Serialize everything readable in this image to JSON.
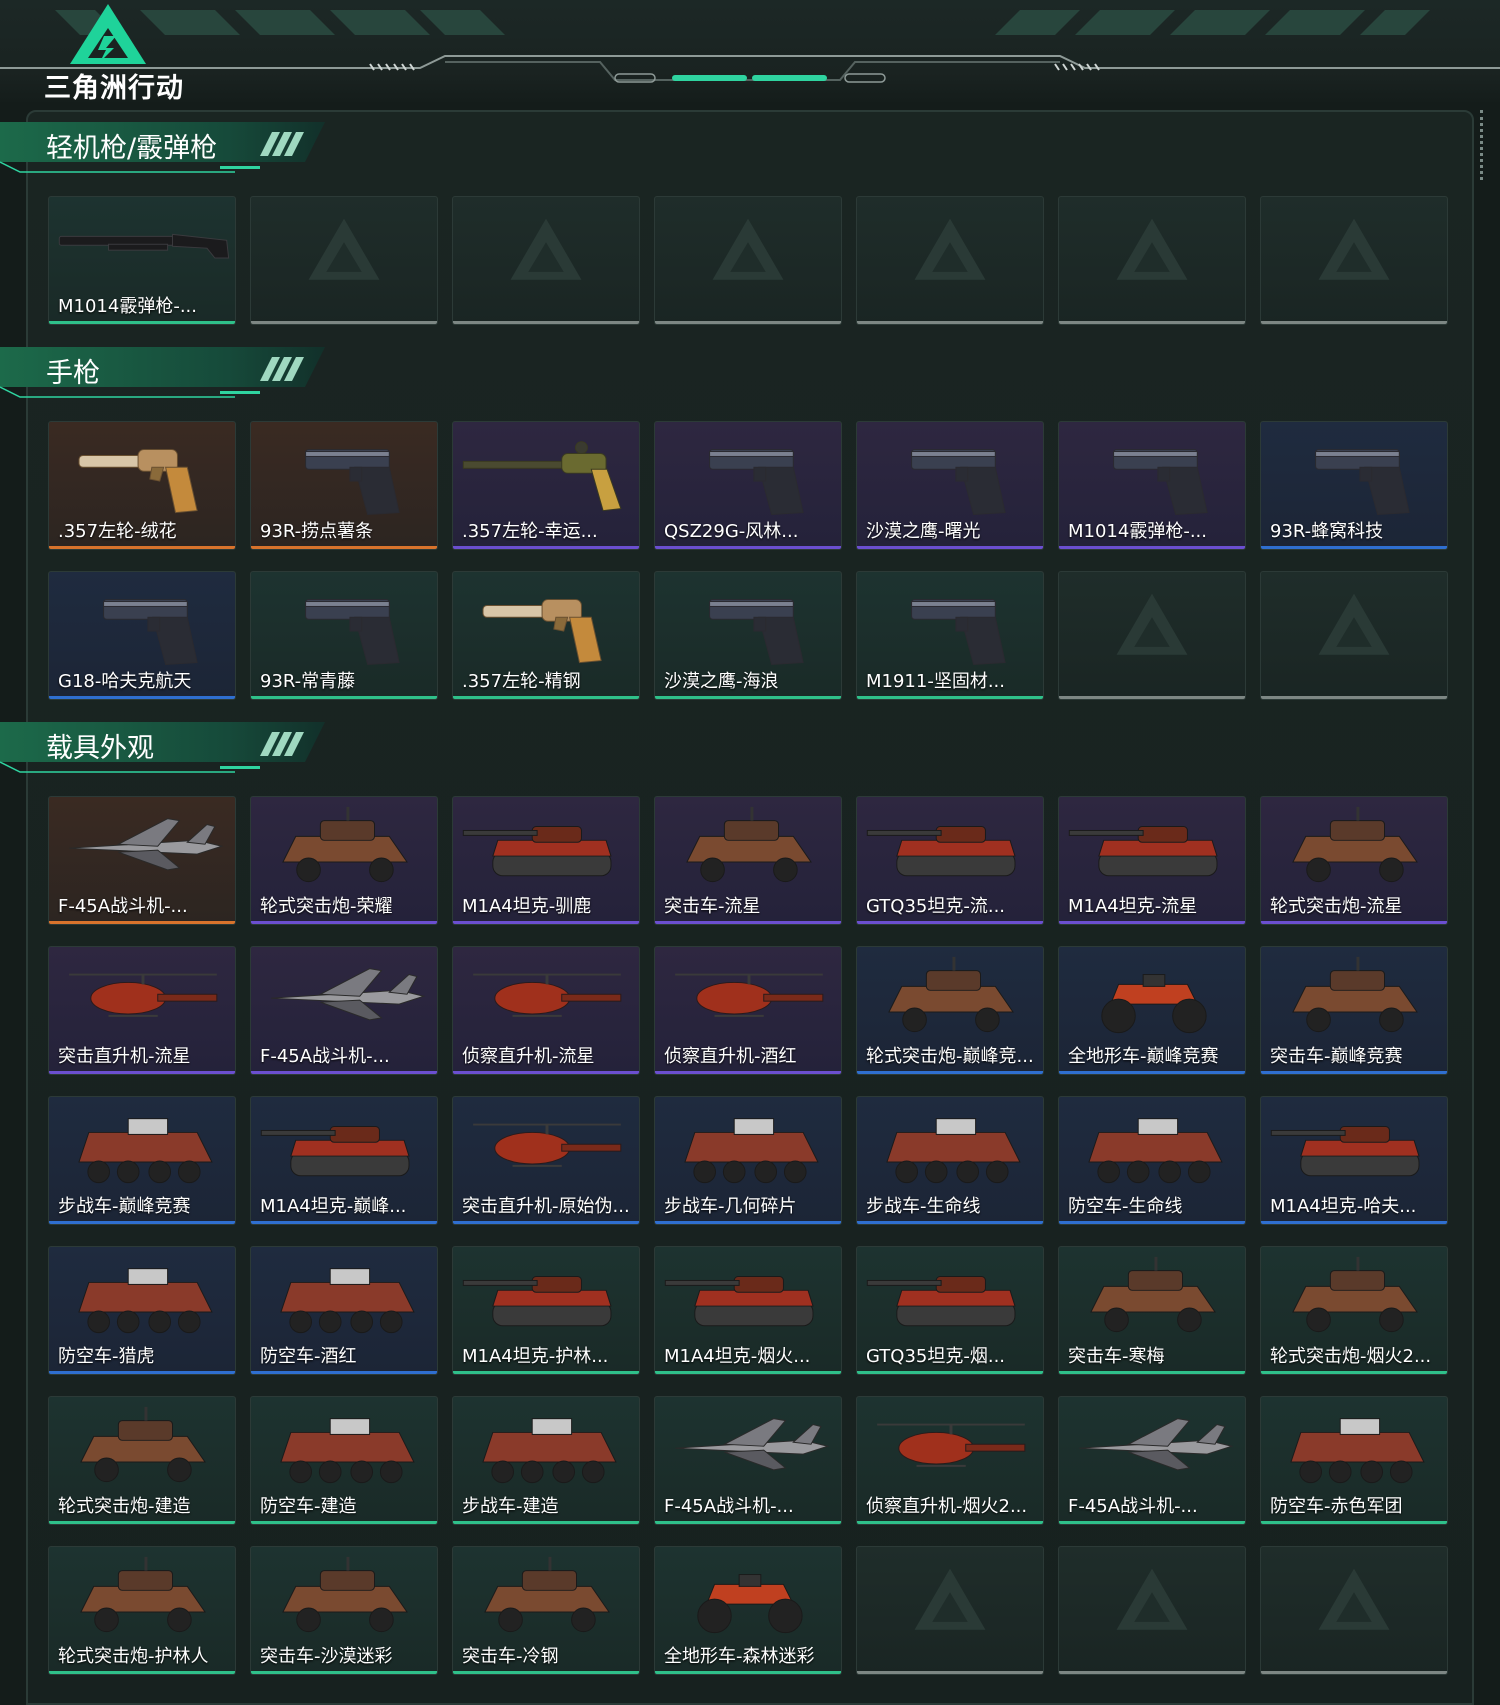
{
  "brand": {
    "logo_text": "三角洲行动"
  },
  "sections": [
    {
      "title": "轻机枪/霰弹枪",
      "items": [
        {
          "label": "M1014霰弹枪-...",
          "rarity": "green",
          "icon": "shotgun"
        },
        {
          "label": "",
          "rarity": "empty",
          "icon": ""
        },
        {
          "label": "",
          "rarity": "empty",
          "icon": ""
        },
        {
          "label": "",
          "rarity": "empty",
          "icon": ""
        },
        {
          "label": "",
          "rarity": "empty",
          "icon": ""
        },
        {
          "label": "",
          "rarity": "empty",
          "icon": ""
        },
        {
          "label": "",
          "rarity": "empty",
          "icon": ""
        }
      ]
    },
    {
      "title": "手枪",
      "items": [
        {
          "label": ".357左轮-绒花",
          "rarity": "orange",
          "icon": "revolver"
        },
        {
          "label": "93R-捞点薯条",
          "rarity": "orange",
          "icon": "pistol"
        },
        {
          "label": ".357左轮-幸运...",
          "rarity": "purple",
          "icon": "long-revolver"
        },
        {
          "label": "QSZ29G-风林...",
          "rarity": "purple",
          "icon": "pistol"
        },
        {
          "label": "沙漠之鹰-曙光",
          "rarity": "purple",
          "icon": "pistol"
        },
        {
          "label": "M1014霰弹枪-...",
          "rarity": "purple",
          "icon": "pistol"
        },
        {
          "label": "93R-蜂窝科技",
          "rarity": "blue",
          "icon": "pistol"
        },
        {
          "label": "G18-哈夫克航天",
          "rarity": "blue",
          "icon": "pistol"
        },
        {
          "label": "93R-常青藤",
          "rarity": "green",
          "icon": "pistol"
        },
        {
          "label": ".357左轮-精钢",
          "rarity": "green",
          "icon": "revolver"
        },
        {
          "label": "沙漠之鹰-海浪",
          "rarity": "green",
          "icon": "pistol"
        },
        {
          "label": "M1911-坚固材...",
          "rarity": "green",
          "icon": "pistol"
        },
        {
          "label": "",
          "rarity": "empty",
          "icon": ""
        },
        {
          "label": "",
          "rarity": "empty",
          "icon": ""
        }
      ]
    },
    {
      "title": "载具外观",
      "items": [
        {
          "label": "F-45A战斗机-...",
          "rarity": "orange",
          "icon": "jet"
        },
        {
          "label": "轮式突击炮-荣耀",
          "rarity": "purple",
          "icon": "car"
        },
        {
          "label": "M1A4坦克-驯鹿",
          "rarity": "purple",
          "icon": "tank"
        },
        {
          "label": "突击车-流星",
          "rarity": "purple",
          "icon": "car"
        },
        {
          "label": "GTQ35坦克-流...",
          "rarity": "purple",
          "icon": "tank"
        },
        {
          "label": "M1A4坦克-流星",
          "rarity": "purple",
          "icon": "tank"
        },
        {
          "label": "轮式突击炮-流星",
          "rarity": "purple",
          "icon": "car"
        },
        {
          "label": "突击直升机-流星",
          "rarity": "purple",
          "icon": "heli"
        },
        {
          "label": "F-45A战斗机-...",
          "rarity": "purple",
          "icon": "jet"
        },
        {
          "label": "侦察直升机-流星",
          "rarity": "purple",
          "icon": "heli"
        },
        {
          "label": "侦察直升机-酒红",
          "rarity": "purple",
          "icon": "heli"
        },
        {
          "label": "轮式突击炮-巅峰竞...",
          "rarity": "blue",
          "icon": "car"
        },
        {
          "label": "全地形车-巅峰竞赛",
          "rarity": "blue",
          "icon": "atv"
        },
        {
          "label": "突击车-巅峰竞赛",
          "rarity": "blue",
          "icon": "car"
        },
        {
          "label": "步战车-巅峰竞赛",
          "rarity": "blue",
          "icon": "apc"
        },
        {
          "label": "M1A4坦克-巅峰...",
          "rarity": "blue",
          "icon": "tank"
        },
        {
          "label": "突击直升机-原始伪...",
          "rarity": "blue",
          "icon": "heli"
        },
        {
          "label": "步战车-几何碎片",
          "rarity": "blue",
          "icon": "apc"
        },
        {
          "label": "步战车-生命线",
          "rarity": "blue",
          "icon": "apc"
        },
        {
          "label": "防空车-生命线",
          "rarity": "blue",
          "icon": "apc"
        },
        {
          "label": "M1A4坦克-哈夫...",
          "rarity": "blue",
          "icon": "tank"
        },
        {
          "label": "防空车-猎虎",
          "rarity": "blue",
          "icon": "apc"
        },
        {
          "label": "防空车-酒红",
          "rarity": "blue",
          "icon": "apc"
        },
        {
          "label": "M1A4坦克-护林...",
          "rarity": "green",
          "icon": "tank"
        },
        {
          "label": "M1A4坦克-烟火...",
          "rarity": "green",
          "icon": "tank"
        },
        {
          "label": "GTQ35坦克-烟...",
          "rarity": "green",
          "icon": "tank"
        },
        {
          "label": "突击车-寒梅",
          "rarity": "green",
          "icon": "car"
        },
        {
          "label": "轮式突击炮-烟火2...",
          "rarity": "green",
          "icon": "car"
        },
        {
          "label": "轮式突击炮-建造",
          "rarity": "green",
          "icon": "car"
        },
        {
          "label": "防空车-建造",
          "rarity": "green",
          "icon": "apc"
        },
        {
          "label": "步战车-建造",
          "rarity": "green",
          "icon": "apc"
        },
        {
          "label": "F-45A战斗机-...",
          "rarity": "green",
          "icon": "jet"
        },
        {
          "label": "侦察直升机-烟火2...",
          "rarity": "green",
          "icon": "heli"
        },
        {
          "label": "F-45A战斗机-...",
          "rarity": "green",
          "icon": "jet"
        },
        {
          "label": "防空车-赤色军团",
          "rarity": "green",
          "icon": "apc"
        },
        {
          "label": "轮式突击炮-护林人",
          "rarity": "green",
          "icon": "car"
        },
        {
          "label": "突击车-沙漠迷彩",
          "rarity": "green",
          "icon": "car"
        },
        {
          "label": "突击车-冷钢",
          "rarity": "green",
          "icon": "car"
        },
        {
          "label": "全地形车-森林迷彩",
          "rarity": "green",
          "icon": "atv"
        },
        {
          "label": "",
          "rarity": "empty",
          "icon": ""
        },
        {
          "label": "",
          "rarity": "empty",
          "icon": ""
        },
        {
          "label": "",
          "rarity": "empty",
          "icon": ""
        }
      ]
    }
  ]
}
